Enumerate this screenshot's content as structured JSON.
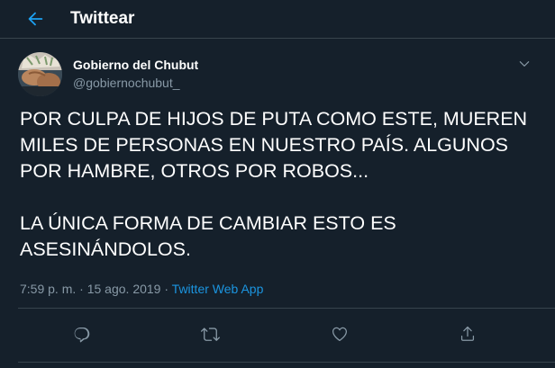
{
  "header": {
    "title": "Twittear",
    "back_icon": "arrow-left-icon",
    "accent_color": "#1da1f2"
  },
  "tweet": {
    "author_name": "Gobierno del Chubut",
    "author_handle": "@gobiernochubut_",
    "menu_icon": "chevron-down-icon",
    "text": "POR CULPA DE HIJOS DE PUTA COMO ESTE, MUEREN MILES DE PERSONAS EN NUESTRO PAÍS. ALGUNOS POR HAMBRE, OTROS POR ROBOS...\n\nLA ÚNICA FORMA DE CAMBIAR ESTO ES ASESINÁNDOLOS.",
    "time": "7:59 p. m.",
    "separator": " · ",
    "date": "15 ago. 2019",
    "source_app": "Twitter Web App"
  },
  "actions": {
    "reply_icon": "reply-icon",
    "retweet_icon": "retweet-icon",
    "like_icon": "heart-icon",
    "share_icon": "share-icon"
  },
  "colors": {
    "background": "#15202b",
    "secondary_text": "#8899a6",
    "link": "#1b95e0",
    "border": "#38444d"
  }
}
